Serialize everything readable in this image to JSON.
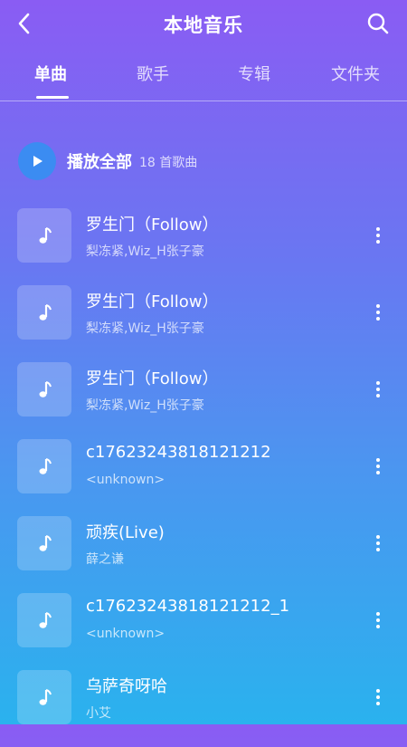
{
  "header": {
    "title": "本地音乐",
    "back_icon": "chevron-left-icon",
    "search_icon": "search-icon"
  },
  "tabs": [
    {
      "label": "单曲",
      "active": true
    },
    {
      "label": "歌手",
      "active": false
    },
    {
      "label": "专辑",
      "active": false
    },
    {
      "label": "文件夹",
      "active": false
    }
  ],
  "play_all": {
    "label": "播放全部",
    "count": "18 首歌曲",
    "icon": "play-icon"
  },
  "songs": [
    {
      "title": "罗生门（Follow）",
      "artist": "梨冻紧,Wiz_H张子豪"
    },
    {
      "title": "罗生门（Follow）",
      "artist": "梨冻紧,Wiz_H张子豪"
    },
    {
      "title": "罗生门（Follow）",
      "artist": "梨冻紧,Wiz_H张子豪"
    },
    {
      "title": "c17623243818121212",
      "artist": "<unknown>"
    },
    {
      "title": "顽疾(Live)",
      "artist": "薛之谦"
    },
    {
      "title": "c17623243818121212_1",
      "artist": "<unknown>"
    },
    {
      "title": "乌萨奇呀哈",
      "artist": "小艾"
    }
  ],
  "colors": {
    "gradient_top": "#8a5cf3",
    "gradient_bottom": "#2ab2ee",
    "play_button": "#3b8cf2"
  }
}
